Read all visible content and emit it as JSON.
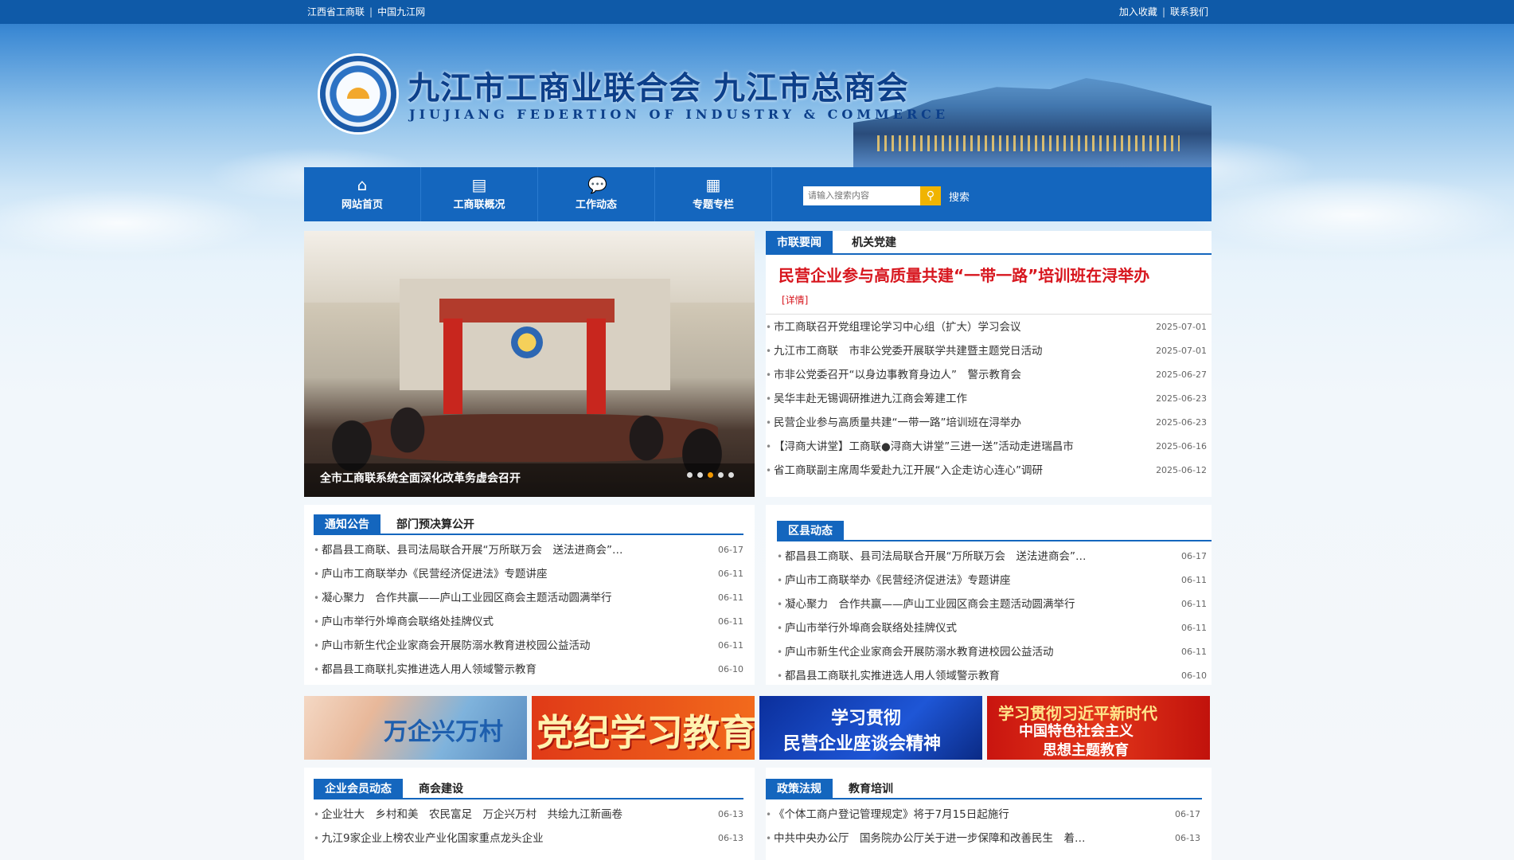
{
  "topbar": {
    "left": [
      "江西省工商联",
      "中国九江网"
    ],
    "right": [
      "加入收藏",
      "联系我们"
    ]
  },
  "header": {
    "title": "九江市工商业联合会 九江市总商会",
    "subtitle": "JIUJIANG FEDERTION OF INDUSTRY & COMMERCE"
  },
  "nav": {
    "items": [
      {
        "label": "网站首页",
        "icon": "home-icon"
      },
      {
        "label": "工商联概况",
        "icon": "news-icon"
      },
      {
        "label": "工作动态",
        "icon": "chat-icon"
      },
      {
        "label": "专题专栏",
        "icon": "printer-icon"
      }
    ],
    "search_placeholder": "请输入搜索内容",
    "search_label": "搜索"
  },
  "slider": {
    "caption": "全市工商联系统全面深化改革务虚会召开",
    "dots": 5,
    "active_dot": 3
  },
  "news": {
    "tabs": [
      "市联要闻",
      "机关党建"
    ],
    "headline": "民营企业参与高质量共建“一带一路”培训班在浔举办",
    "more": "[详情]",
    "items": [
      {
        "title": "市工商联召开党组理论学习中心组（扩大）学习会议",
        "date": "2025-07-01"
      },
      {
        "title": "九江市工商联　市非公党委开展联学共建暨主题党日活动",
        "date": "2025-07-01"
      },
      {
        "title": "市非公党委召开“以身边事教育身边人”　警示教育会",
        "date": "2025-06-27"
      },
      {
        "title": "吴华丰赴无锡调研推进九江商会筹建工作",
        "date": "2025-06-23"
      },
      {
        "title": "民营企业参与高质量共建“一带一路”培训班在浔举办",
        "date": "2025-06-23"
      },
      {
        "title": "【浔商大讲堂】工商联●浔商大讲堂”三进一送”活动走进瑞昌市",
        "date": "2025-06-16"
      },
      {
        "title": "省工商联副主席周华爱赴九江开展“入企走访心连心”调研",
        "date": "2025-06-12"
      }
    ]
  },
  "notice": {
    "tabs": [
      "通知公告",
      "部门预决算公开"
    ],
    "items": [
      {
        "title": "都昌县工商联、县司法局联合开展“万所联万会　送法进商会”…",
        "date": "06-17"
      },
      {
        "title": "庐山市工商联举办《民营经济促进法》专题讲座",
        "date": "06-11"
      },
      {
        "title": "凝心聚力　合作共赢——庐山工业园区商会主题活动圆满举行",
        "date": "06-11"
      },
      {
        "title": "庐山市举行外埠商会联络处挂牌仪式",
        "date": "06-11"
      },
      {
        "title": "庐山市新生代企业家商会开展防溺水教育进校园公益活动",
        "date": "06-11"
      },
      {
        "title": "都昌县工商联扎实推进选人用人领域警示教育",
        "date": "06-10"
      }
    ]
  },
  "county": {
    "tabs": [
      "区县动态"
    ],
    "items": [
      {
        "title": "都昌县工商联、县司法局联合开展“万所联万会　送法进商会”…",
        "date": "06-17"
      },
      {
        "title": "庐山市工商联举办《民营经济促进法》专题讲座",
        "date": "06-11"
      },
      {
        "title": "凝心聚力　合作共赢——庐山工业园区商会主题活动圆满举行",
        "date": "06-11"
      },
      {
        "title": "庐山市举行外埠商会联络处挂牌仪式",
        "date": "06-11"
      },
      {
        "title": "庐山市新生代企业家商会开展防溺水教育进校园公益活动",
        "date": "06-11"
      },
      {
        "title": "都昌县工商联扎实推进选人用人领域警示教育",
        "date": "06-10"
      }
    ]
  },
  "ads": {
    "ad1": "万企兴万村",
    "ad2": "党纪学习教育",
    "ad3_line1": "学习贯彻",
    "ad3_line2": "民营企业座谈会精神",
    "ad4_line1": "学习贯彻习近平新时代",
    "ad4_line2": "中国特色社会主义",
    "ad4_line3": "思想主题教育"
  },
  "member": {
    "tabs": [
      "企业会员动态",
      "商会建设"
    ],
    "items": [
      {
        "title": "企业壮大　乡村和美　农民富足　万企兴万村　共绘九江新画卷",
        "date": "06-13"
      },
      {
        "title": "九江9家企业上榜农业产业化国家重点龙头企业",
        "date": "06-13"
      }
    ]
  },
  "policy": {
    "tabs": [
      "政策法规",
      "教育培训"
    ],
    "items": [
      {
        "title": "《个体工商户登记管理规定》将于7月15日起施行",
        "date": "06-17"
      },
      {
        "title": "中共中央办公厅　国务院办公厅关于进一步保障和改善民生　着…",
        "date": "06-13"
      }
    ]
  }
}
